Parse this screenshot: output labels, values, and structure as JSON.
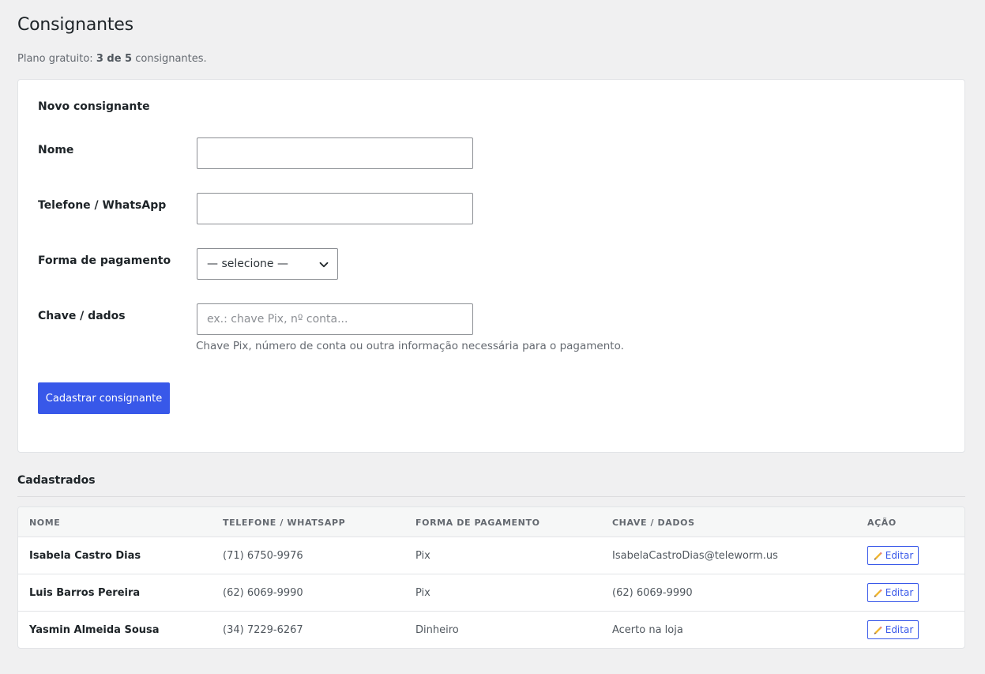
{
  "page": {
    "title": "Consignantes",
    "plan_prefix": "Plano gratuito: ",
    "plan_count": "3 de 5",
    "plan_suffix": " consignantes."
  },
  "form": {
    "title": "Novo consignante",
    "name_label": "Nome",
    "name_value": "",
    "phone_label": "Telefone / WhatsApp",
    "phone_value": "",
    "payment_label": "Forma de pagamento",
    "payment_selected": "— selecione —",
    "key_label": "Chave / dados",
    "key_placeholder": "ex.: chave Pix, nº conta...",
    "key_help": "Chave Pix, número de conta ou outra informação necessária para o pagamento.",
    "submit_label": "Cadastrar consignante"
  },
  "list": {
    "title": "Cadastrados",
    "columns": [
      "NOME",
      "TELEFONE / WHATSAPP",
      "FORMA DE PAGAMENTO",
      "CHAVE / DADOS",
      "AÇÃO"
    ],
    "rows": [
      {
        "name": "Isabela Castro Dias",
        "phone": "(71) 6750-9976",
        "payment": "Pix",
        "key": "IsabelaCastroDias@teleworm.us",
        "action": "Editar"
      },
      {
        "name": "Luis Barros Pereira",
        "phone": "(62) 6069-9990",
        "payment": "Pix",
        "key": "(62) 6069-9990",
        "action": "Editar"
      },
      {
        "name": "Yasmin Almeida Sousa",
        "phone": "(34) 7229-6267",
        "payment": "Dinheiro",
        "key": "Acerto na loja",
        "action": "Editar"
      }
    ]
  },
  "colors": {
    "accent": "#3858e9",
    "background": "#f0f0f1"
  },
  "icons": {
    "select": "chevron-down-icon",
    "edit": "pencil-icon"
  }
}
